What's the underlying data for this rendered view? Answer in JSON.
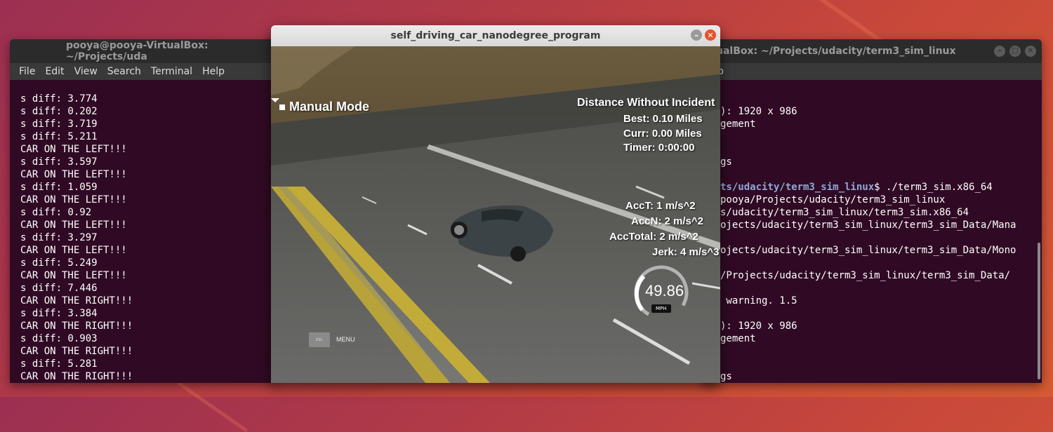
{
  "left_terminal": {
    "title": "pooya@pooya-VirtualBox: ~/Projects/uda",
    "menu": [
      "File",
      "Edit",
      "View",
      "Search",
      "Terminal",
      "Help"
    ],
    "lines": [
      "s diff: 3.774",
      "s diff: 0.202",
      "s diff: 3.719",
      "s diff: 5.211",
      "CAR ON THE LEFT!!!",
      "s diff: 3.597",
      "CAR ON THE LEFT!!!",
      "s diff: 1.059",
      "CAR ON THE LEFT!!!",
      "s diff: 0.92",
      "CAR ON THE LEFT!!!",
      "s diff: 3.297",
      "CAR ON THE LEFT!!!",
      "s diff: 5.249",
      "CAR ON THE LEFT!!!",
      "s diff: 7.446",
      "CAR ON THE RIGHT!!!",
      "s diff: 3.384",
      "CAR ON THE RIGHT!!!",
      "s diff: 0.903",
      "CAR ON THE RIGHT!!!",
      "s diff: 5.281",
      "CAR ON THE RIGHT!!!"
    ]
  },
  "right_terminal": {
    "title": "ualBox: ~/Projects/udacity/term3_sim_linux",
    "menu_partial": "p",
    "lines": [
      "",
      "): 1920 x 986",
      "gement",
      "",
      "",
      "gs",
      "",
      "ts/udacity/term3_sim_linux",
      "pooya/Projects/udacity/term3_sim_linux",
      "s/udacity/term3_sim_linux/term3_sim.x86_64",
      "ojects/udacity/term3_sim_linux/term3_sim_Data/Mana",
      "",
      "ojects/udacity/term3_sim_linux/term3_sim_Data/Mono",
      "",
      "/Projects/udacity/term3_sim_linux/term3_sim_Data/",
      "",
      " warning. 1.5",
      "",
      "): 1920 x 986",
      "gement",
      "",
      "",
      "gs"
    ],
    "prompt_command": "$ ./term3_sim.x86_64"
  },
  "simulator": {
    "title": "self_driving_car_nanodegree_program",
    "mode": "Manual Mode",
    "distance_header": "Distance Without Incident",
    "best": "Best: 0.10 Miles",
    "curr": "Curr: 0.00 Miles",
    "timer": "Timer: 0:00:00",
    "acc_t": "AccT: 1 m/s^2",
    "acc_n": "AccN: 2 m/s^2",
    "acc_total": "AccTotal: 2 m/s^2",
    "jerk": "Jerk: 4 m/s^3",
    "speed": "49.86",
    "speed_unit": "MPH",
    "esc_label": "ESC",
    "menu_label": "MENU",
    "speed_gauge_fraction": 0.5
  }
}
